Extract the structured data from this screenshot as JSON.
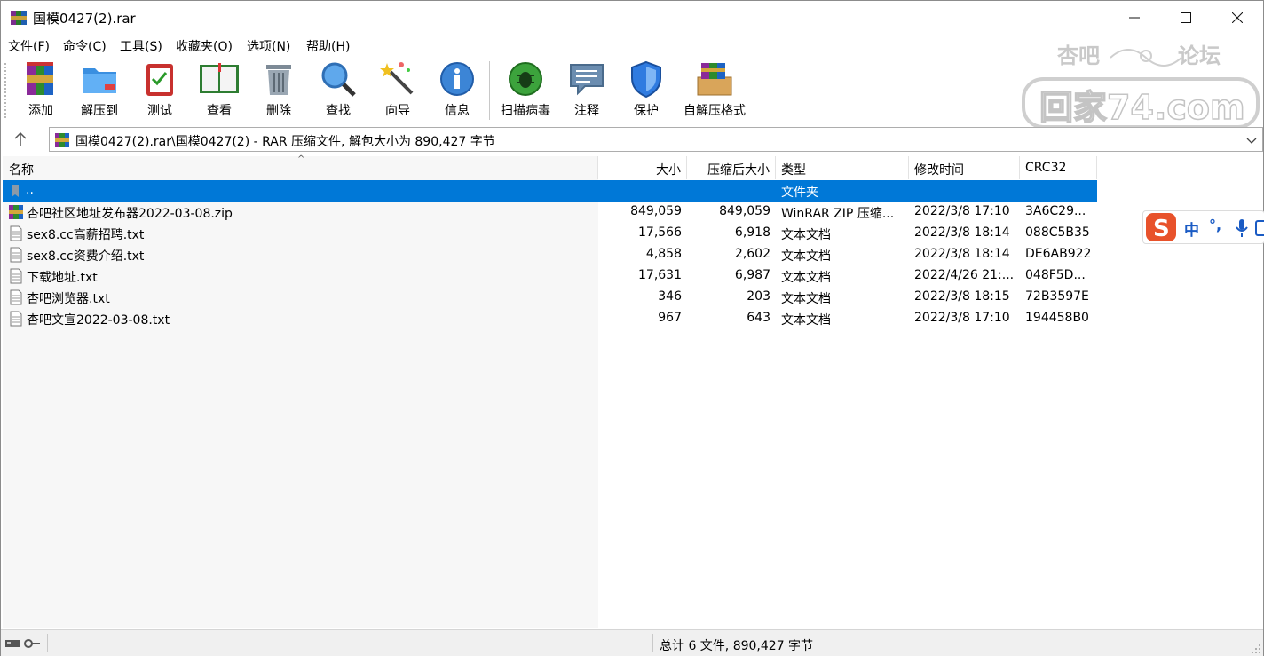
{
  "window": {
    "title": "国模0427(2).rar",
    "minimize": "—",
    "maximize": "☐",
    "close": "✕"
  },
  "menu": [
    {
      "label": "文件(F)"
    },
    {
      "label": "命令(C)"
    },
    {
      "label": "工具(S)"
    },
    {
      "label": "收藏夹(O)"
    },
    {
      "label": "选项(N)"
    },
    {
      "label": "帮助(H)"
    }
  ],
  "toolbar": [
    {
      "label": "添加",
      "icon": "add-archive-icon"
    },
    {
      "label": "解压到",
      "icon": "extract-folder-icon"
    },
    {
      "label": "测试",
      "icon": "test-clipboard-icon"
    },
    {
      "label": "查看",
      "icon": "view-book-icon"
    },
    {
      "label": "删除",
      "icon": "trash-icon"
    },
    {
      "label": "查找",
      "icon": "magnifier-icon"
    },
    {
      "label": "向导",
      "icon": "wizard-wand-icon"
    },
    {
      "label": "信息",
      "icon": "info-icon"
    },
    {
      "label": "扫描病毒",
      "icon": "virus-scan-icon"
    },
    {
      "label": "注释",
      "icon": "comment-icon"
    },
    {
      "label": "保护",
      "icon": "shield-icon"
    },
    {
      "label": "自解压格式",
      "icon": "sfx-box-icon"
    }
  ],
  "watermark": {
    "line1a": "杏吧",
    "line1b": "论坛",
    "line2": "回家74.com"
  },
  "address": {
    "path": "国模0427(2).rar\\国模0427(2) - RAR 压缩文件, 解包大小为 890,427 字节"
  },
  "columns": {
    "name": "名称",
    "size": "大小",
    "packed": "压缩后大小",
    "type": "类型",
    "modified": "修改时间",
    "crc": "CRC32"
  },
  "files": [
    {
      "name": "..",
      "size": "",
      "packed": "",
      "type": "文件夹",
      "modified": "",
      "crc": "",
      "icon": "parent-folder-icon"
    },
    {
      "name": "杏吧社区地址发布器2022-03-08.zip",
      "size": "849,059",
      "packed": "849,059",
      "type": "WinRAR ZIP 压缩...",
      "modified": "2022/3/8 17:10",
      "crc": "3A6C29...",
      "icon": "zip-archive-icon"
    },
    {
      "name": "sex8.cc高薪招聘.txt",
      "size": "17,566",
      "packed": "6,918",
      "type": "文本文档",
      "modified": "2022/3/8 18:14",
      "crc": "088C5B35",
      "icon": "text-file-icon"
    },
    {
      "name": "sex8.cc资费介绍.txt",
      "size": "4,858",
      "packed": "2,602",
      "type": "文本文档",
      "modified": "2022/3/8 18:14",
      "crc": "DE6AB922",
      "icon": "text-file-icon"
    },
    {
      "name": "下载地址.txt",
      "size": "17,631",
      "packed": "6,987",
      "type": "文本文档",
      "modified": "2022/4/26 21:...",
      "crc": "048F5D...",
      "icon": "text-file-icon"
    },
    {
      "name": "杏吧浏览器.txt",
      "size": "346",
      "packed": "203",
      "type": "文本文档",
      "modified": "2022/3/8 18:15",
      "crc": "72B3597E",
      "icon": "text-file-icon"
    },
    {
      "name": "杏吧文宣2022-03-08.txt",
      "size": "967",
      "packed": "643",
      "type": "文本文档",
      "modified": "2022/3/8 17:10",
      "crc": "194458B0",
      "icon": "text-file-icon"
    }
  ],
  "status": {
    "summary": "总计 6 文件, 890,427 字节"
  },
  "ime": {
    "mode": "中",
    "punct": "°,"
  },
  "colors": {
    "selection": "#0078d7",
    "accent": "#e8522b"
  }
}
